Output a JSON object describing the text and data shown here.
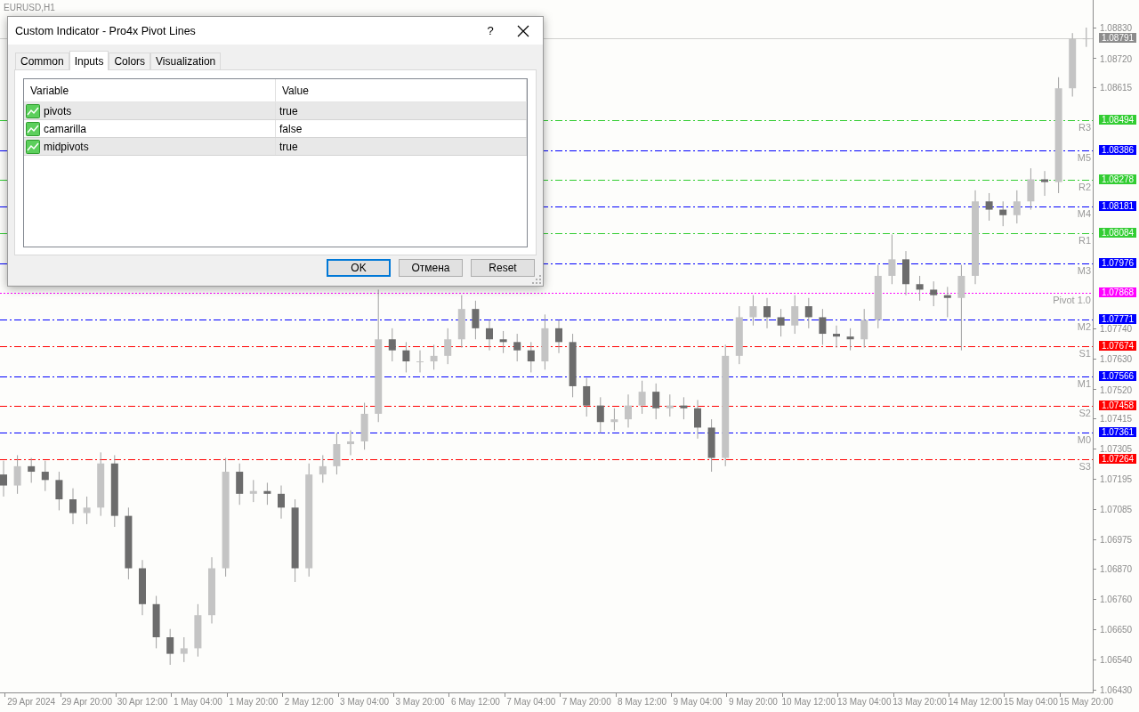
{
  "chart": {
    "symbol": "EURUSD,H1",
    "chart_data": {
      "type": "candlestick",
      "categories": [
        null,
        null,
        "29 Apr 2024",
        null,
        null,
        null,
        "29 Apr 20:00",
        null,
        null,
        null,
        "30 Apr 12:00",
        null,
        null,
        null,
        "1 May 04:00",
        null,
        null,
        null,
        "1 May 20:00",
        null,
        null,
        null,
        "2 May 12:00",
        null,
        null,
        null,
        "3 May 04:00",
        null,
        null,
        null,
        "3 May 20:00",
        null,
        null,
        null,
        "6 May 12:00",
        null,
        null,
        null,
        "7 May 04:00",
        null,
        null,
        null,
        "7 May 20:00",
        null,
        null,
        null,
        "8 May 12:00",
        null,
        null,
        null,
        "9 May 04:00",
        null,
        null,
        null,
        "9 May 20:00",
        null,
        null,
        null,
        "10 May 12:00",
        null,
        null,
        null,
        "13 May 04:00",
        null,
        null,
        null,
        "13 May 20:00",
        null,
        null,
        null,
        "14 May 12:00",
        null,
        null,
        null,
        "15 May 04:00",
        null,
        null,
        null,
        "15 May 20:00"
      ],
      "ohlc": [
        [
          1.0721,
          1.0726,
          1.0713,
          1.0717
        ],
        [
          1.0717,
          1.0728,
          1.0714,
          1.0724
        ],
        [
          1.0724,
          1.0727,
          1.0718,
          1.0722
        ],
        [
          1.0722,
          1.0726,
          1.0715,
          1.0719
        ],
        [
          1.0719,
          1.0722,
          1.0708,
          1.0712
        ],
        [
          1.0712,
          1.0716,
          1.0703,
          1.0707
        ],
        [
          1.0707,
          1.0713,
          1.0703,
          1.0709
        ],
        [
          1.0709,
          1.0729,
          1.0706,
          1.0725
        ],
        [
          1.0725,
          1.0728,
          1.0702,
          1.0706
        ],
        [
          1.0706,
          1.0709,
          1.0683,
          1.0687
        ],
        [
          1.0687,
          1.069,
          1.067,
          1.0674
        ],
        [
          1.0674,
          1.0677,
          1.0658,
          1.0662
        ],
        [
          1.0662,
          1.0665,
          1.0652,
          1.0656
        ],
        [
          1.0656,
          1.0662,
          1.0653,
          1.0658
        ],
        [
          1.0658,
          1.0674,
          1.0655,
          1.067
        ],
        [
          1.067,
          1.0691,
          1.0667,
          1.0687
        ],
        [
          1.0687,
          1.0727,
          1.0684,
          1.0722
        ],
        [
          1.0722,
          1.0725,
          1.071,
          1.0714
        ],
        [
          1.0714,
          1.0719,
          1.0711,
          1.0715
        ],
        [
          1.0715,
          1.0718,
          1.071,
          1.0714
        ],
        [
          1.0714,
          1.0717,
          1.0705,
          1.0709
        ],
        [
          1.0709,
          1.0712,
          1.0682,
          1.0687
        ],
        [
          1.0687,
          1.0725,
          1.0684,
          1.0721
        ],
        [
          1.0721,
          1.0728,
          1.0718,
          1.0724
        ],
        [
          1.0724,
          1.0736,
          1.0721,
          1.0732
        ],
        [
          1.0732,
          1.0737,
          1.0728,
          1.0733
        ],
        [
          1.0733,
          1.0747,
          1.073,
          1.0743
        ],
        [
          1.0743,
          1.0788,
          1.074,
          1.077
        ],
        [
          1.077,
          1.0774,
          1.0762,
          1.0766
        ],
        [
          1.0766,
          1.0769,
          1.0758,
          1.0762
        ],
        [
          1.0762,
          1.0766,
          1.0758,
          1.0762
        ],
        [
          1.0762,
          1.0768,
          1.0759,
          1.0764
        ],
        [
          1.0764,
          1.0774,
          1.0761,
          1.077
        ],
        [
          1.077,
          1.0786,
          1.0767,
          1.0781
        ],
        [
          1.0781,
          1.0784,
          1.077,
          1.0774
        ],
        [
          1.0774,
          1.0777,
          1.0766,
          1.077
        ],
        [
          1.077,
          1.0773,
          1.0765,
          1.0769
        ],
        [
          1.0769,
          1.0772,
          1.0762,
          1.0766
        ],
        [
          1.0766,
          1.0769,
          1.0758,
          1.0762
        ],
        [
          1.0762,
          1.0779,
          1.0759,
          1.0774
        ],
        [
          1.0774,
          1.0777,
          1.0765,
          1.0769
        ],
        [
          1.0769,
          1.0772,
          1.0749,
          1.0753
        ],
        [
          1.0753,
          1.0756,
          1.0742,
          1.0746
        ],
        [
          1.0746,
          1.0749,
          1.0736,
          1.074
        ],
        [
          1.074,
          1.0745,
          1.0737,
          1.0741
        ],
        [
          1.0741,
          1.075,
          1.0738,
          1.0746
        ],
        [
          1.0746,
          1.0755,
          1.0743,
          1.0751
        ],
        [
          1.0751,
          1.0754,
          1.0741,
          1.0745
        ],
        [
          1.0745,
          1.075,
          1.0742,
          1.0746
        ],
        [
          1.0746,
          1.0749,
          1.0741,
          1.0745
        ],
        [
          1.0745,
          1.0748,
          1.0734,
          1.0738
        ],
        [
          1.0738,
          1.0741,
          1.0722,
          1.0727
        ],
        [
          1.0727,
          1.0768,
          1.0724,
          1.0764
        ],
        [
          1.0764,
          1.0782,
          1.0761,
          1.0778
        ],
        [
          1.0778,
          1.0786,
          1.0775,
          1.0782
        ],
        [
          1.0782,
          1.0785,
          1.0774,
          1.0778
        ],
        [
          1.0778,
          1.0781,
          1.0771,
          1.0775
        ],
        [
          1.0775,
          1.0786,
          1.0772,
          1.0782
        ],
        [
          1.0782,
          1.0785,
          1.0774,
          1.0778
        ],
        [
          1.0778,
          1.0781,
          1.0768,
          1.0772
        ],
        [
          1.0772,
          1.0775,
          1.0767,
          1.0771
        ],
        [
          1.0771,
          1.0774,
          1.0766,
          1.077
        ],
        [
          1.077,
          1.0781,
          1.0767,
          1.0777
        ],
        [
          1.0777,
          1.0797,
          1.0774,
          1.0793
        ],
        [
          1.0793,
          1.0808,
          1.079,
          1.0799
        ],
        [
          1.0799,
          1.0802,
          1.0786,
          1.079
        ],
        [
          1.079,
          1.0793,
          1.0784,
          1.0788
        ],
        [
          1.0788,
          1.0791,
          1.0782,
          1.0786
        ],
        [
          1.0786,
          1.0789,
          1.0778,
          1.0785
        ],
        [
          1.0785,
          1.0797,
          1.0766,
          1.0793
        ],
        [
          1.0793,
          1.0824,
          1.079,
          1.082
        ],
        [
          1.082,
          1.0823,
          1.0813,
          1.0817
        ],
        [
          1.0817,
          1.082,
          1.0811,
          1.0815
        ],
        [
          1.0815,
          1.0824,
          1.0812,
          1.082
        ],
        [
          1.082,
          1.0832,
          1.0817,
          1.0828
        ],
        [
          1.0828,
          1.0831,
          1.0822,
          1.0827
        ],
        [
          1.0827,
          1.0865,
          1.0823,
          1.0861
        ],
        [
          1.0861,
          1.0881,
          1.0858,
          1.0879
        ],
        [
          1.0879,
          1.0883,
          1.0876,
          1.08791
        ]
      ],
      "ylim": [
        1.0642,
        1.0893
      ],
      "yticks": [
        {
          "value": 1.0883,
          "label": "1.08830"
        },
        {
          "value": 1.0872,
          "label": "1.08720"
        },
        {
          "value": 1.08615,
          "label": "1.08615"
        },
        {
          "value": 1.0774,
          "label": "1.07740"
        },
        {
          "value": 1.0763,
          "label": "1.07630"
        },
        {
          "value": 1.0752,
          "label": "1.07520"
        },
        {
          "value": 1.07415,
          "label": "1.07415"
        },
        {
          "value": 1.07305,
          "label": "1.07305"
        },
        {
          "value": 1.07195,
          "label": "1.07195"
        },
        {
          "value": 1.07085,
          "label": "1.07085"
        },
        {
          "value": 1.06975,
          "label": "1.06975"
        },
        {
          "value": 1.0687,
          "label": "1.06870"
        },
        {
          "value": 1.0676,
          "label": "1.06760"
        },
        {
          "value": 1.0665,
          "label": "1.06650"
        },
        {
          "value": 1.0654,
          "label": "1.06540"
        },
        {
          "value": 1.0643,
          "label": "1.06430"
        }
      ]
    },
    "price_lines": [
      {
        "price": "1.08791",
        "kind": "current",
        "color": "#8c8c8c"
      },
      {
        "label": "R3",
        "price": "1.08494",
        "kind": "resistance",
        "color": "#32cd32"
      },
      {
        "label": "M5",
        "price": "1.08386",
        "kind": "mid",
        "color": "#0000ff"
      },
      {
        "label": "R2",
        "price": "1.08278",
        "kind": "resistance",
        "color": "#32cd32"
      },
      {
        "label": "M4",
        "price": "1.08181",
        "kind": "mid",
        "color": "#0000ff"
      },
      {
        "label": "R1",
        "price": "1.08084",
        "kind": "resistance",
        "color": "#32cd32"
      },
      {
        "label": "M3",
        "price": "1.07976",
        "kind": "mid",
        "color": "#0000ff"
      },
      {
        "label": "Pivot 1.0",
        "price": "1.07868",
        "kind": "pivot",
        "color": "#ff00ff"
      },
      {
        "label": "M2",
        "price": "1.07771",
        "kind": "mid",
        "color": "#0000ff"
      },
      {
        "label": "S1",
        "price": "1.07674",
        "kind": "support",
        "color": "#ff0000"
      },
      {
        "label": "M1",
        "price": "1.07566",
        "kind": "mid",
        "color": "#0000ff"
      },
      {
        "label": "S2",
        "price": "1.07458",
        "kind": "support",
        "color": "#ff0000"
      },
      {
        "label": "M0",
        "price": "1.07361",
        "kind": "mid",
        "color": "#0000ff"
      },
      {
        "label": "S3",
        "price": "1.07264",
        "kind": "support",
        "color": "#ff0000"
      }
    ]
  },
  "dialog": {
    "title": "Custom Indicator - Pro4x Pivot Lines",
    "help": "?",
    "tabs": [
      {
        "label": "Common",
        "selected": false
      },
      {
        "label": "Inputs",
        "selected": true
      },
      {
        "label": "Colors",
        "selected": false
      },
      {
        "label": "Visualization",
        "selected": false
      }
    ],
    "table": {
      "columns": [
        "Variable",
        "Value"
      ],
      "rows": [
        {
          "variable": "pivots",
          "value": "true"
        },
        {
          "variable": "camarilla",
          "value": "false"
        },
        {
          "variable": "midpivots",
          "value": "true"
        }
      ]
    },
    "buttons": [
      {
        "label": "OK",
        "default": true
      },
      {
        "label": "Отмена",
        "default": false
      },
      {
        "label": "Reset",
        "default": false
      }
    ]
  }
}
